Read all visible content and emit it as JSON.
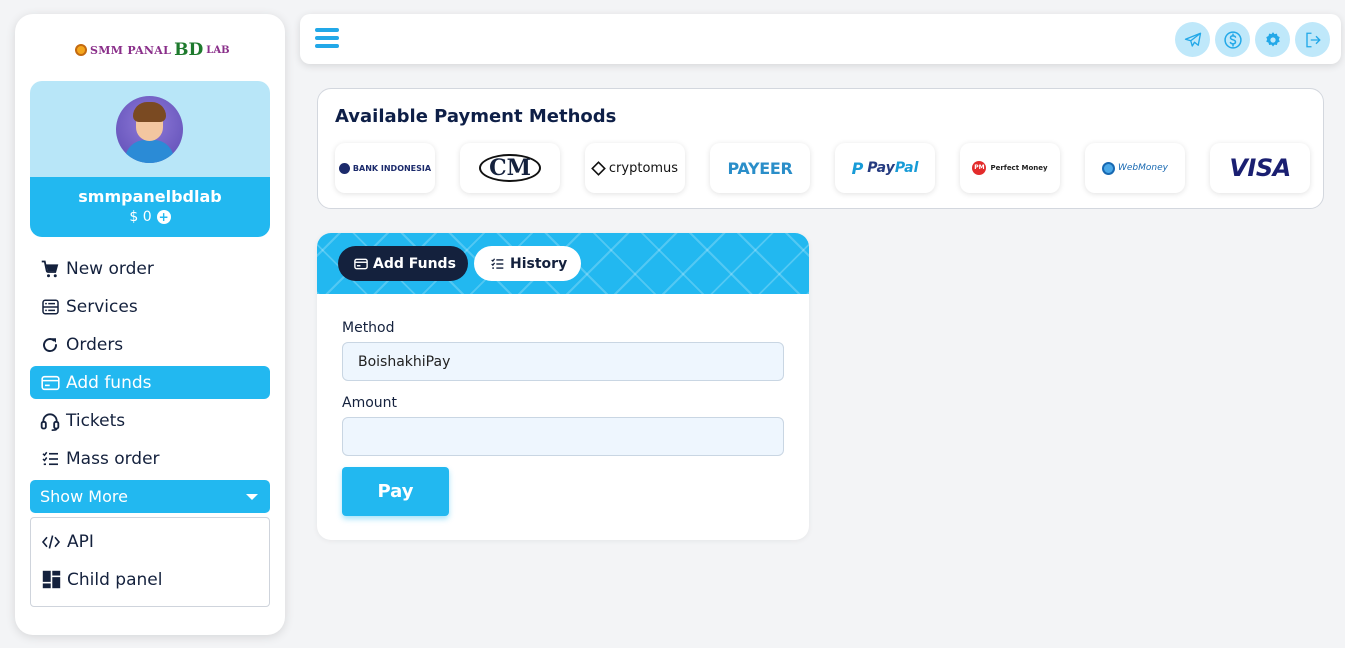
{
  "brand": {
    "logo_text_1": "SMM PANAL",
    "logo_text_2": "BD",
    "logo_text_3": "LAB"
  },
  "profile": {
    "username": "smmpanelbdlab",
    "balance": "$ 0",
    "add_balance_icon": "plus-circle-icon"
  },
  "menu": [
    {
      "label": "New order",
      "icon": "cart-icon",
      "active": false
    },
    {
      "label": "Services",
      "icon": "services-icon",
      "active": false
    },
    {
      "label": "Orders",
      "icon": "refresh-icon",
      "active": false
    },
    {
      "label": "Add funds",
      "icon": "card-icon",
      "active": true
    },
    {
      "label": "Tickets",
      "icon": "headset-icon",
      "active": false
    },
    {
      "label": "Mass order",
      "icon": "list-check-icon",
      "active": false
    }
  ],
  "show_more": {
    "label": "Show More"
  },
  "submenu": [
    {
      "label": "API",
      "icon": "code-icon"
    },
    {
      "label": "Child panel",
      "icon": "dashboard-icon"
    }
  ],
  "topbar": {
    "icons": [
      "telegram-icon",
      "dollar-icon",
      "gear-icon",
      "logout-icon"
    ]
  },
  "payment_methods": {
    "title": "Available Payment Methods",
    "logos": [
      {
        "name": "bank-indonesia",
        "text": "BANK INDONESIA"
      },
      {
        "name": "cm",
        "text": "CM"
      },
      {
        "name": "cryptomus",
        "text": "cryptomus"
      },
      {
        "name": "payeer",
        "text": "PAYEER"
      },
      {
        "name": "paypal",
        "text_1": "Pay",
        "text_2": "Pal"
      },
      {
        "name": "perfect-money",
        "text": "Perfect Money",
        "badge": "PM"
      },
      {
        "name": "webmoney",
        "text": "WebMoney"
      },
      {
        "name": "visa",
        "text": "VISA"
      }
    ]
  },
  "funds": {
    "tabs": {
      "add_funds": "Add Funds",
      "history": "History"
    },
    "method_label": "Method",
    "method_value": "BoishakhiPay",
    "amount_label": "Amount",
    "amount_value": "",
    "pay_label": "Pay"
  },
  "colors": {
    "accent": "#22b8f0",
    "dark": "#14213d",
    "profile_bg": "#b8e6f8"
  }
}
